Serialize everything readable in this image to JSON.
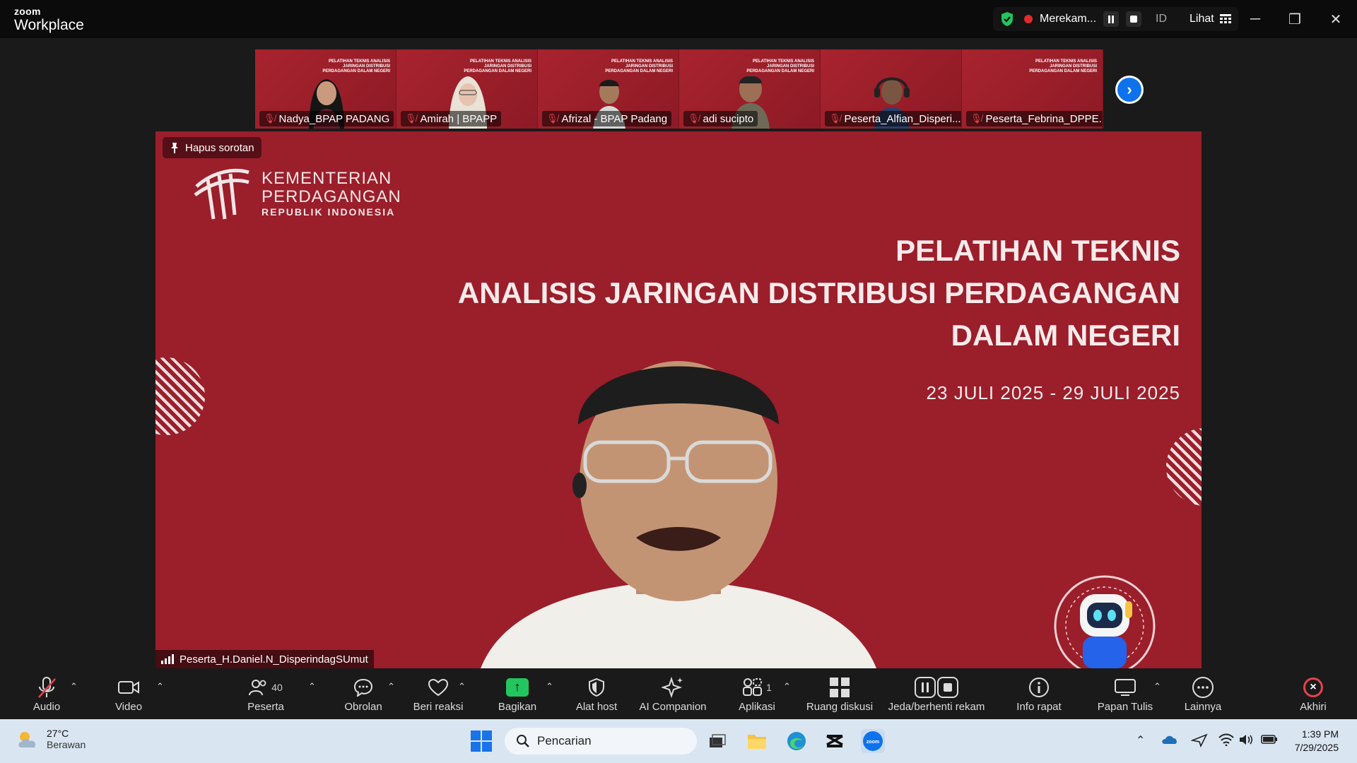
{
  "window": {
    "brand_small": "zoom",
    "brand_big": "Workplace",
    "recording_label": "Merekam...",
    "language": "ID",
    "view_label": "Lihat",
    "minimize": "─",
    "restore": "❐",
    "close": "✕"
  },
  "participants": [
    {
      "name": "Nadya_BPAP PADANG"
    },
    {
      "name": "Amirah | BPAPP"
    },
    {
      "name": "Afrizal - BPAP Padang"
    },
    {
      "name": "adi sucipto"
    },
    {
      "name": "Peserta_Alfian_Disperi..."
    },
    {
      "name": "Peserta_Febrina_DPPE..."
    }
  ],
  "thumb_slide_text": "PELATIHAN TEKNIS ANALISIS JARINGAN DISTRIBUSI PERDAGANGAN DALAM NEGERI",
  "main": {
    "spotlight_label": "Hapus sorotan",
    "logo_line1": "KEMENTERIAN",
    "logo_line2": "PERDAGANGAN",
    "logo_line3": "REPUBLIK INDONESIA",
    "title1": "PELATIHAN TEKNIS",
    "title2": "ANALISIS JARINGAN DISTRIBUSI PERDAGANGAN",
    "title3": "DALAM NEGERI",
    "dates": "23 JULI 2025 - 29 JULI 2025",
    "speaker_name": "Peserta_H.Daniel.N_DisperindagSUmut"
  },
  "toolbar": {
    "audio": "Audio",
    "video": "Video",
    "participants": "Peserta",
    "participants_count": "40",
    "chat": "Obrolan",
    "reactions": "Beri reaksi",
    "share": "Bagikan",
    "host_tools": "Alat host",
    "ai_companion": "AI Companion",
    "apps": "Aplikasi",
    "apps_count": "1",
    "breakout": "Ruang diskusi",
    "pause_record": "Jeda/berhenti rekam",
    "meeting_info": "Info rapat",
    "whiteboard": "Papan Tulis",
    "more": "Lainnya",
    "end": "Akhiri"
  },
  "taskbar": {
    "temperature": "27°C",
    "weather": "Berawan",
    "search_placeholder": "Pencarian",
    "time": "1:39 PM",
    "date": "7/29/2025"
  },
  "colors": {
    "slide_red": "#9b1e2b",
    "zoom_blue": "#0e72ed",
    "share_green": "#22c55e",
    "end_red": "#e5424d"
  }
}
